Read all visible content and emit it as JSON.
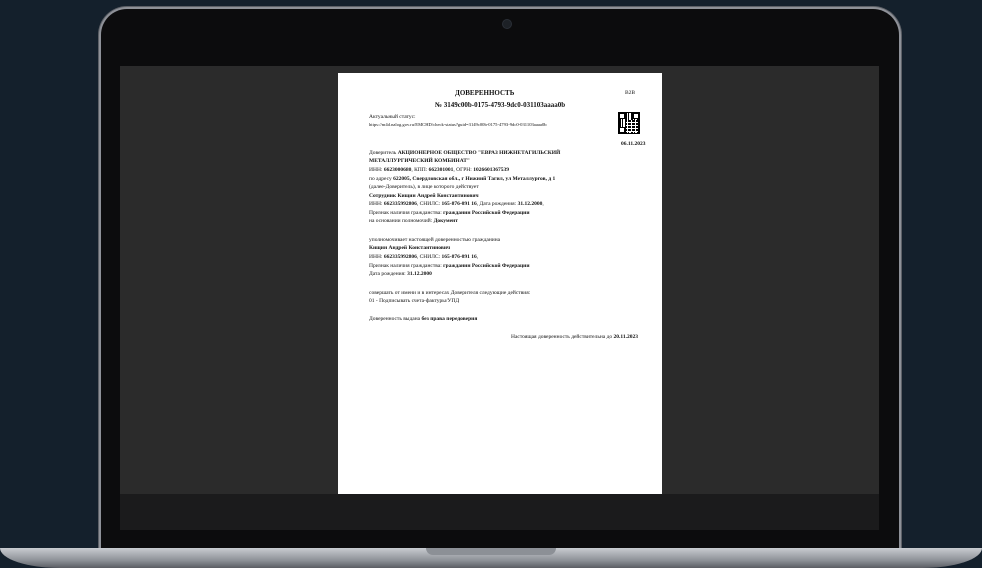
{
  "document": {
    "title": "ДОВЕРЕННОСТЬ",
    "badge": "B2B",
    "number": "№ 3149c00b-0175-4793-9dc0-031103aaaa0b",
    "status_label": "Актуальный статус:",
    "status_url": "https://m4d.nalog.gov.ru/EMCHD/check-status?guid=3149c00b-0175-4793-9dc0-031103aaaa0b",
    "date": "06.11.2023",
    "principal": {
      "prefix": "Доверитель",
      "name_line1": "АКЦИОНЕРНОЕ ОБЩЕСТВО \"ЕВРАЗ НИЖНЕТАГИЛЬСКИЙ",
      "name_line2": "МЕТАЛЛУРГИЧЕСКИЙ КОМБИНАТ\"",
      "inn_label": "ИНН:",
      "inn": "6623000680",
      "kpp_label": ", КПП:",
      "kpp": "662301001",
      "ogrn_label": ", ОГРН:",
      "ogrn": "1026601367539",
      "address_prefix": "по адресу",
      "address": "622005, Свердловская обл., г Нижний Тагил, ул Металлургов, д 1",
      "acting_line": "(далее-Доверитель), в лице которого действует",
      "employee": "Сотрудник Кищин Андрей Константинович",
      "emp_inn_label": "ИНН:",
      "emp_inn": "662335992806",
      "snils_label": ", СНИЛС:",
      "snils": "165-876-091 16",
      "birth_label": ", Дата рождения:",
      "birth": "31.12.2000",
      "citizen_label": "Признак наличия гражданства:",
      "citizen": "гражданин Российской Федерации",
      "basis_label": "на основании полномочий:",
      "basis": "Документ"
    },
    "representative": {
      "intro": "уполномочивает настоящей доверенностью гражданина",
      "name": "Кищин Андрей Константинович",
      "inn_label": "ИНН:",
      "inn": "662335992806",
      "snils_label": ", СНИЛС:",
      "snils": "165-876-091 16",
      "citizen_label": "Признак наличия гражданства:",
      "citizen": "гражданин Российской Федерации",
      "birth_label": "Дата рождения:",
      "birth": "31.12.2000"
    },
    "actions_intro": "совершать от имени и в интересах Доверителя следующие действия:",
    "action_1": "01 - Подписывать счета-фактуры/УПД",
    "issued_label": "Доверенность выдана",
    "issued_value": "без права передоверия",
    "valid_label": "Настоящая доверенность действительна до",
    "valid_until": "20.11.2023"
  }
}
